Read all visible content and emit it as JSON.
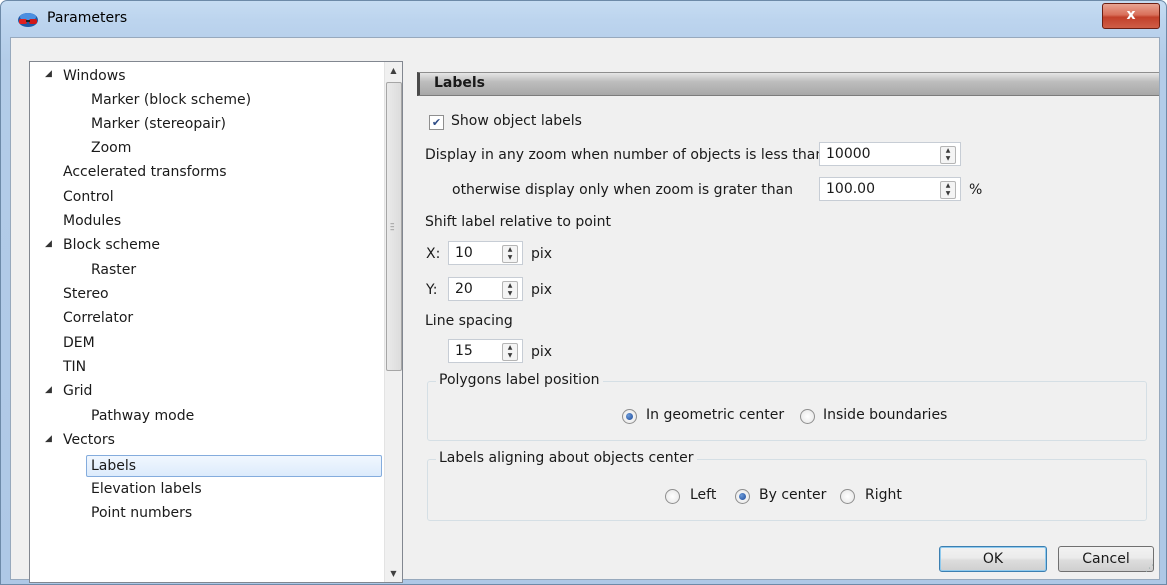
{
  "window": {
    "title": "Parameters",
    "close_label": "x"
  },
  "tree": {
    "items": [
      {
        "label": "Windows",
        "expander": "expanded"
      },
      {
        "label": "Marker (block scheme)"
      },
      {
        "label": "Marker (stereopair)"
      },
      {
        "label": "Zoom"
      },
      {
        "label": "Accelerated transforms"
      },
      {
        "label": "Control"
      },
      {
        "label": "Modules"
      },
      {
        "label": "Block scheme",
        "expander": "expanded"
      },
      {
        "label": "Raster"
      },
      {
        "label": "Stereo"
      },
      {
        "label": "Correlator"
      },
      {
        "label": "DEM"
      },
      {
        "label": "TIN"
      },
      {
        "label": "Grid",
        "expander": "expanded"
      },
      {
        "label": "Pathway mode"
      },
      {
        "label": "Vectors",
        "expander": "expanded"
      },
      {
        "label": "Labels",
        "selected": true
      },
      {
        "label": "Elevation labels"
      },
      {
        "label": "Point numbers"
      }
    ]
  },
  "panel": {
    "header": "Labels",
    "show_labels": {
      "label": "Show object labels",
      "checked": true
    },
    "display_zoom_label": "Display in any zoom when number of objects is less than",
    "display_zoom_value": "10000",
    "otherwise_label": "otherwise display only when zoom is grater than",
    "otherwise_value": "100.00",
    "otherwise_unit": "%",
    "shift_label": "Shift label relative to point",
    "x_label": "X:",
    "x_value": "10",
    "y_label": "Y:",
    "y_value": "20",
    "pix_unit": "pix",
    "line_spacing_label": "Line spacing",
    "line_spacing_value": "15",
    "polygons_group": {
      "title": "Polygons label position",
      "options": [
        "In geometric center",
        "Inside boundaries"
      ],
      "selected": "In geometric center"
    },
    "align_group": {
      "title": "Labels aligning about objects center",
      "options": [
        "Left",
        "By center",
        "Right"
      ],
      "selected": "By center"
    }
  },
  "buttons": {
    "ok": "OK",
    "cancel": "Cancel"
  },
  "colors": {
    "title_bar": "#b9d1ea",
    "close_button": "#c94a33",
    "selection": "#dcebfc",
    "header_bar": "#a8a8a8"
  }
}
